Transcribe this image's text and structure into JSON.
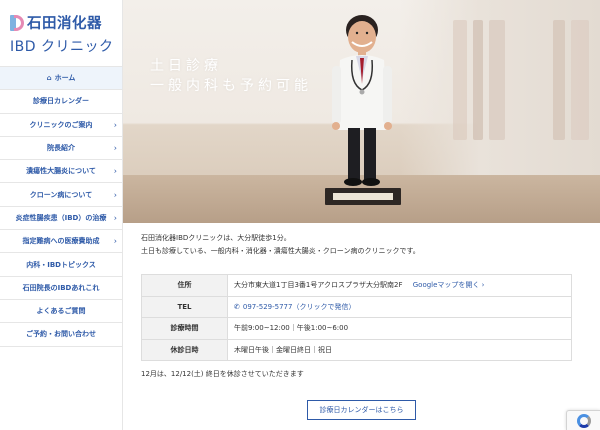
{
  "brand": {
    "name_jp": "石田消化器",
    "name_en_prefix": "IBD",
    "name_en_suffix": "クリニック"
  },
  "nav": [
    {
      "label": "ホーム",
      "active": true,
      "chevron": false
    },
    {
      "label": "診療日カレンダー",
      "chevron": false
    },
    {
      "label": "クリニックのご案内",
      "chevron": true
    },
    {
      "label": "院長紹介",
      "chevron": true
    },
    {
      "label": "潰瘍性大腸炎について",
      "chevron": true
    },
    {
      "label": "クローン病について",
      "chevron": true
    },
    {
      "label": "炎症性腸疾患（IBD）の治療",
      "chevron": true
    },
    {
      "label": "指定難病への医療費助成",
      "chevron": true
    },
    {
      "label": "内科・IBDトピックス",
      "chevron": false
    },
    {
      "label": "石田院長のIBDあれこれ",
      "chevron": false
    },
    {
      "label": "よくあるご質問",
      "chevron": false
    },
    {
      "label": "ご予約・お問い合わせ",
      "chevron": false
    }
  ],
  "hero": {
    "line1": "土日診療",
    "line2": "一般内科も予約可能"
  },
  "intro": {
    "line1": "石田消化器IBDクリニックは、大分駅徒歩1分。",
    "line2": "土日も診療している、一般内科・消化器・潰瘍性大腸炎・クローン病のクリニックです。"
  },
  "info": {
    "address_label": "住所",
    "address_value": "大分市東大道1丁目3番1号アクロスプラザ大分駅南2F",
    "map_link": "Googleマップを開く ›",
    "tel_label": "TEL",
    "tel_value": "097-529-5777（クリックで発信）",
    "hours_label": "診療時間",
    "hours_value": "午前9:00~12:00｜午後1:00~6:00",
    "closed_label": "休診日時",
    "closed_value": "木曜日午後｜金曜日終日｜祝日"
  },
  "notice": "12月は、12/12(土) 終日を休診させていただきます",
  "calendar_button": "診療日カレンダーはこちら"
}
